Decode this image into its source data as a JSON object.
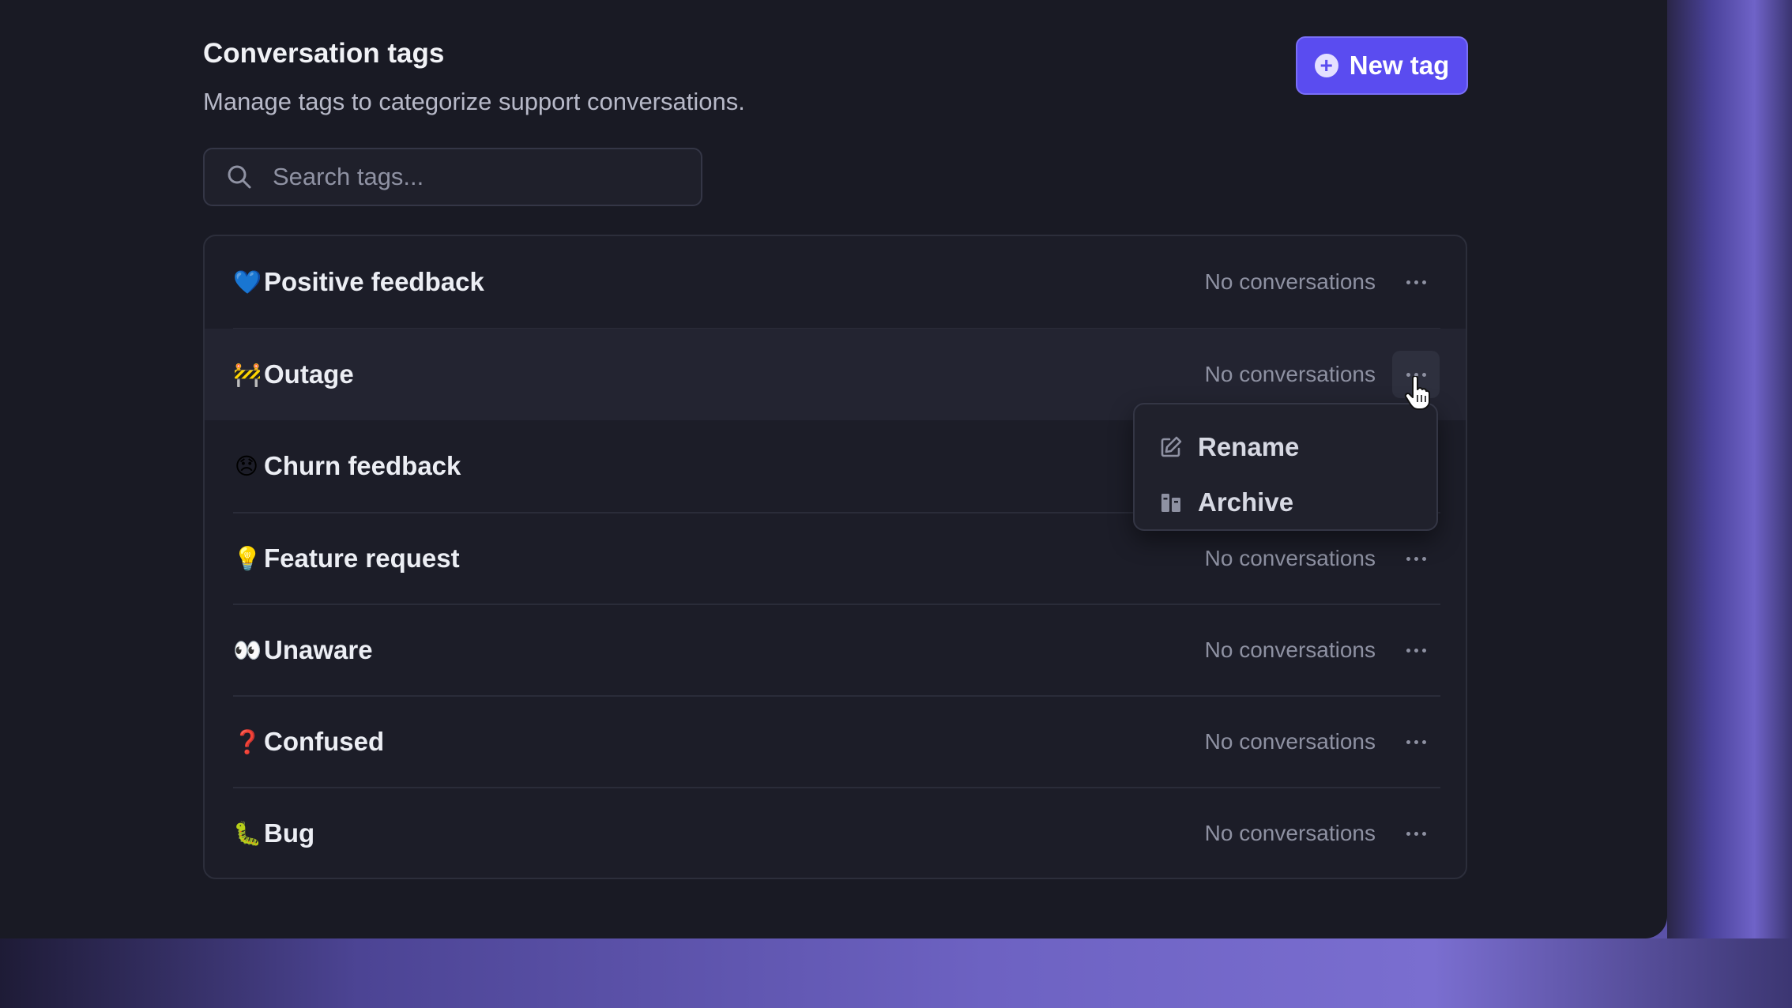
{
  "header": {
    "title": "Conversation tags",
    "subtitle": "Manage tags to categorize support conversations.",
    "new_tag_label": "New tag",
    "new_tag_icon": "plus-circle-icon"
  },
  "search": {
    "placeholder": "Search tags...",
    "value": "",
    "icon": "search-icon"
  },
  "tags": [
    {
      "emoji": "💙",
      "name": "Positive feedback",
      "count_label": "No conversations"
    },
    {
      "emoji": "🚧",
      "name": "Outage",
      "count_label": "No conversations"
    },
    {
      "emoji": "😞",
      "name": "Churn feedback",
      "count_label": ""
    },
    {
      "emoji": "💡",
      "name": "Feature request",
      "count_label": "No conversations"
    },
    {
      "emoji": "👀",
      "name": "Unaware",
      "count_label": "No conversations"
    },
    {
      "emoji": "❓",
      "name": "Confused",
      "count_label": "No conversations"
    },
    {
      "emoji": "🐛",
      "name": "Bug",
      "count_label": "No conversations"
    }
  ],
  "context_menu": {
    "open_for": "Outage",
    "items": [
      {
        "label": "Rename",
        "icon": "edit-icon"
      },
      {
        "label": "Archive",
        "icon": "archive-icon"
      }
    ]
  },
  "colors": {
    "accent": "#5a4cf0",
    "panel_background": "#191a24",
    "text_primary": "#eceef4",
    "text_muted": "#8e91a2"
  }
}
